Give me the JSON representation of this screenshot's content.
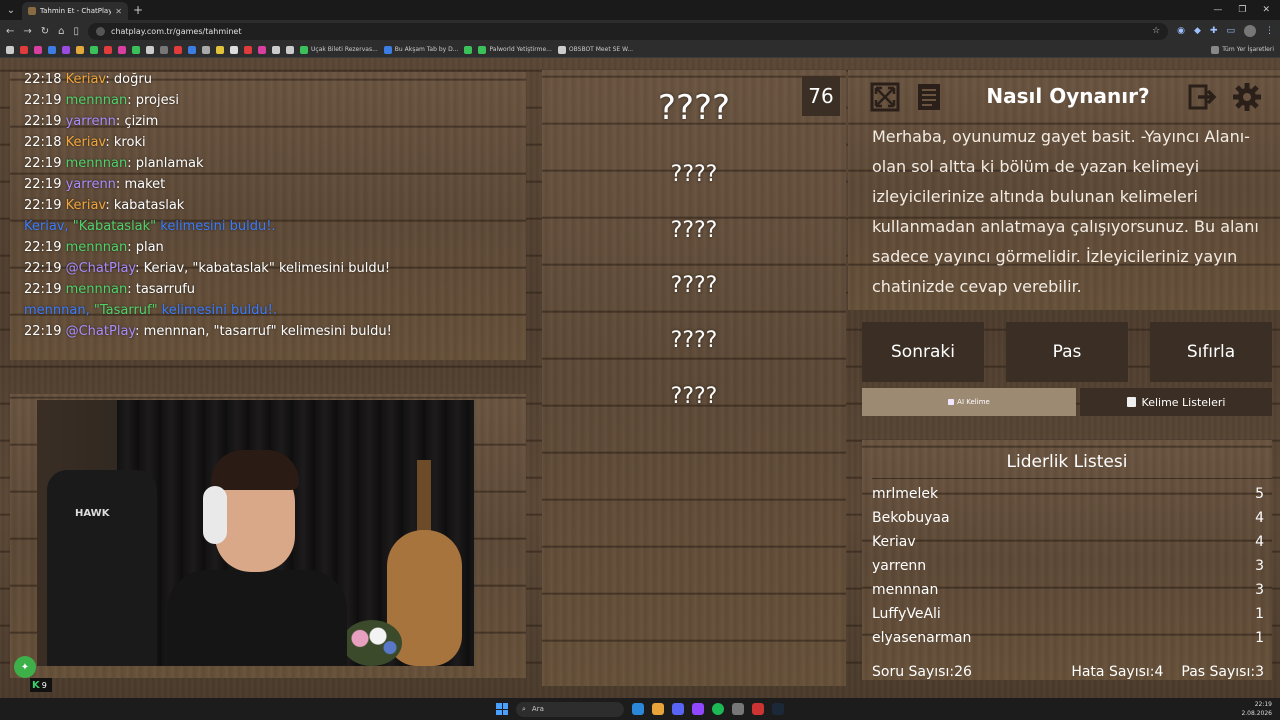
{
  "browser": {
    "tab_title": "Tahmin Et - ChatPlay",
    "url": "chatplay.com.tr/games/tahminet",
    "bookmarks": [
      "Uçak Bileti Rezervas...",
      "Bu Akşam Tab by D...",
      "Palworld Yetiştirme...",
      "OBSBOT Meet SE W..."
    ],
    "all_bookmarks_label": "Tüm Yer İşaretleri"
  },
  "chat": {
    "lines": [
      {
        "time": "22:18",
        "user": "Keriav",
        "msg": "doğru",
        "type": "keriav"
      },
      {
        "time": "22:19",
        "user": "mennnan",
        "msg": "projesi",
        "type": "mennnan"
      },
      {
        "time": "22:19",
        "user": "yarrenn",
        "msg": "çizim",
        "type": "yarrenn"
      },
      {
        "time": "22:18",
        "user": "Keriav",
        "msg": "kroki",
        "type": "keriav"
      },
      {
        "time": "22:19",
        "user": "mennnan",
        "msg": "planlamak",
        "type": "mennnan"
      },
      {
        "time": "22:19",
        "user": "yarrenn",
        "msg": "maket",
        "type": "yarrenn"
      },
      {
        "time": "22:19",
        "user": "Keriav",
        "msg": "kabataslak",
        "type": "keriav"
      }
    ],
    "system1": {
      "user": "Keriav",
      "word": "\"Kabataslak\"",
      "rest": "kelimesini buldu!."
    },
    "line_plan": {
      "time": "22:19",
      "user": "mennnan",
      "msg": "plan"
    },
    "line_bot1": {
      "time": "22:19",
      "user": "@ChatPlay",
      "msg": "Keriav, \"kabataslak\" kelimesini buldu!"
    },
    "line_tas": {
      "time": "22:19",
      "user": "mennnan",
      "msg": "tasarrufu"
    },
    "system2": {
      "user": "mennnan",
      "word": "\"Tasarruf\"",
      "rest": "kelimesini buldu!."
    },
    "line_bot2": {
      "time": "22:19",
      "user": "@ChatPlay",
      "msg": "mennnan, \"tasarruf\" kelimesini buldu!"
    }
  },
  "webcam": {
    "chair_brand": "HAWK"
  },
  "words": {
    "counter": "76",
    "main": "????",
    "hidden": [
      "????",
      "????",
      "????",
      "????",
      "????"
    ]
  },
  "howto": {
    "title": "Nasıl Oynanır?",
    "text": "Merhaba, oyunumuz gayet basit. -Yayıncı Alanı- olan sol altta ki bölüm de yazan kelimeyi izleyicilerinize altında bulunan kelimeleri kullanmadan anlatmaya çalışıyorsunuz. Bu alanı sadece yayıncı görmelidir. İzleyicileriniz yayın chatinizde cevap verebilir."
  },
  "controls": {
    "next": "Sonraki",
    "pass": "Pas",
    "reset": "Sıfırla",
    "ai_word": "AI Kelime",
    "word_lists": "Kelime Listeleri"
  },
  "leaderboard": {
    "title": "Liderlik Listesi",
    "rows": [
      {
        "name": "mrlmelek",
        "score": "5"
      },
      {
        "name": "Bekobuyaa",
        "score": "4"
      },
      {
        "name": "Keriav",
        "score": "4"
      },
      {
        "name": "yarrenn",
        "score": "3"
      },
      {
        "name": "mennnan",
        "score": "3"
      },
      {
        "name": "LuffyVeAli",
        "score": "1"
      },
      {
        "name": "elyasenarman",
        "score": "1"
      }
    ],
    "question_count": "Soru Sayısı:26",
    "error_count": "Hata Sayısı:4",
    "pass_count": "Pas Sayısı:3"
  },
  "overlay": {
    "k9_count": "9"
  },
  "taskbar": {
    "search": "Ara",
    "time": "22:19",
    "date": "2.08.2026"
  },
  "colors": {
    "keriav": "#f0a63c",
    "mennnan": "#4fd26a",
    "yarrenn": "#a98cff",
    "system": "#3a7cff",
    "panel": "#3b2f25"
  }
}
